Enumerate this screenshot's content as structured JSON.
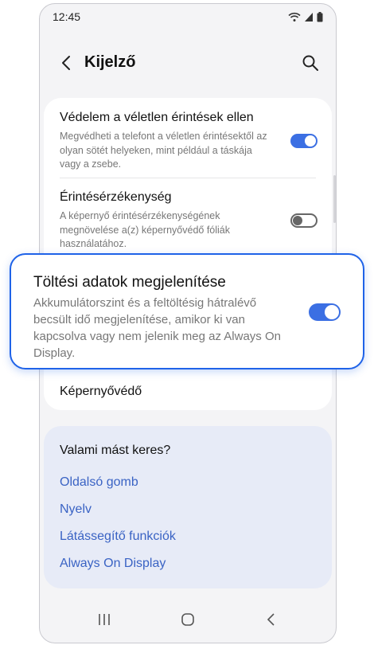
{
  "status_bar": {
    "time": "12:45"
  },
  "header": {
    "title": "Kijelző"
  },
  "settings": [
    {
      "title": "Védelem a véletlen érintések ellen",
      "description": "Megvédheti a telefont a véletlen érintésektől az olyan sötét helyeken, mint például a táskája vagy a zsebe.",
      "toggle": "on"
    },
    {
      "title": "Érintésérzékenység",
      "description": "A képernyő érintésérzékenységének megnövelése a(z) képernyővédő fóliák használatához.",
      "toggle": "off"
    },
    {
      "title": "Töltési adatok megjelenítése",
      "description": "Akkumulátorszint és a feltöltésig hátralévő becsült idő megjelenítése, amikor ki van kapcsolva vagy nem jelenik meg az Always On Display.",
      "toggle": "on"
    },
    {
      "title": "Képernyővédő"
    }
  ],
  "suggestions": {
    "heading": "Valami mást keres?",
    "links": [
      "Oldalsó gomb",
      "Nyelv",
      "Látássegítő funkciók",
      "Always On Display"
    ]
  },
  "colors": {
    "accent": "#3b6fe3",
    "highlight_border": "#1f63e8",
    "link": "#3a63c4"
  }
}
